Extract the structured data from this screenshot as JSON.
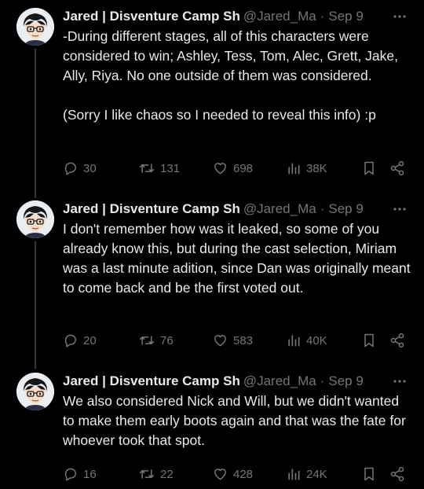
{
  "tweets": [
    {
      "display_name": "Jared | Disventure Camp Sh",
      "handle": "@Jared_Ma",
      "separator": "·",
      "date": "Sep 9",
      "text": "-During different stages, all of this characters were considered to win; Ashley, Tess, Tom, Alec, Grett, Jake, Ally, Riya. No one outside of them was considered.\n\n(Sorry I like chaos so I needed to reveal this info) :p",
      "replies": "30",
      "reposts": "131",
      "likes": "698",
      "views": "38K"
    },
    {
      "display_name": "Jared | Disventure Camp Sh",
      "handle": "@Jared_Ma",
      "separator": "·",
      "date": "Sep 9",
      "text": "I don't remember how was it leaked, so some of you already know this, but during the cast selection, Miriam was a last minute adition, since Dan was originally meant to come back and be the first voted out.",
      "replies": "20",
      "reposts": "76",
      "likes": "583",
      "views": "40K"
    },
    {
      "display_name": "Jared | Disventure Camp Sh",
      "handle": "@Jared_Ma",
      "separator": "·",
      "date": "Sep 9",
      "text": "We also considered Nick and Will, but we didn't wanted to make them early boots again and that was the fate for whoever took that spot.",
      "replies": "16",
      "reposts": "22",
      "likes": "428",
      "views": "24K"
    }
  ],
  "colors": {
    "background": "#000000",
    "primary_text": "#e7e9ea",
    "secondary_text": "#71767b",
    "thread_line": "#333639"
  },
  "icons": {
    "avatar": "cartoon-avatar",
    "more": "more-horizontal-icon",
    "reply": "reply-icon",
    "repost": "repost-icon",
    "like": "heart-icon",
    "views": "views-chart-icon",
    "bookmark": "bookmark-icon",
    "share": "share-icon"
  }
}
